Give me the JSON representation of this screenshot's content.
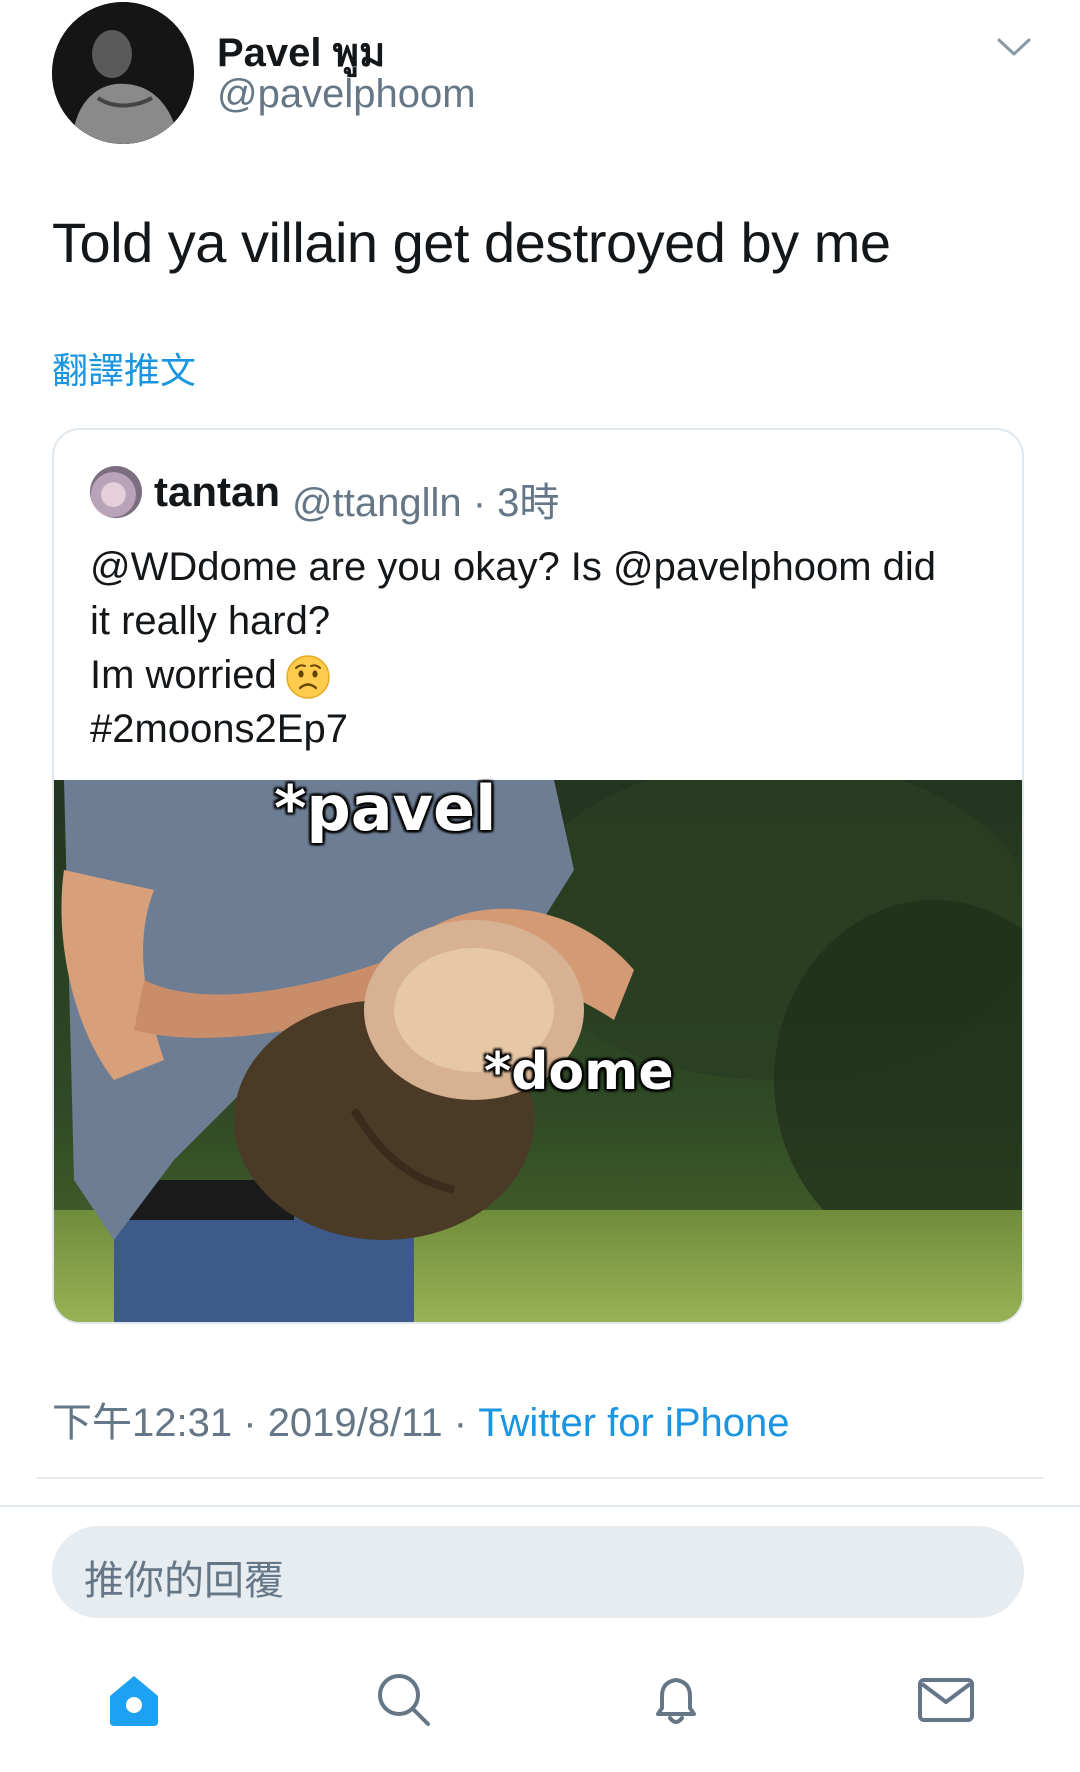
{
  "tweet": {
    "author_name": "Pavel พูม",
    "author_handle": "@pavelphoom",
    "text": "Told ya villain get destroyed by me",
    "translate_label": "翻譯推文"
  },
  "quoted_tweet": {
    "name": "tantan",
    "handle": "@ttanglln",
    "time": "3時",
    "text_lines": [
      "@WDdome are you okay? Is @pavelphoom did",
      "it really hard?",
      "Im worried",
      "#2moons2Ep7"
    ],
    "image_captions": {
      "top": "*pavel",
      "middle": "*dome"
    }
  },
  "meta": {
    "time": "下午12:31",
    "date": "2019/8/11",
    "client": "Twitter for iPhone",
    "separator": "·"
  },
  "reply": {
    "placeholder": "推你的回覆"
  },
  "colors": {
    "accent": "#1b95e0",
    "secondary_text": "#657786",
    "primary_text": "#14171a",
    "reply_bg": "#e6ecf0"
  },
  "icons": {
    "menu": "chevron-down-icon",
    "emoji": "worried-face-emoji",
    "tabs": [
      "home-icon",
      "search-icon",
      "bell-icon",
      "mail-icon"
    ]
  }
}
